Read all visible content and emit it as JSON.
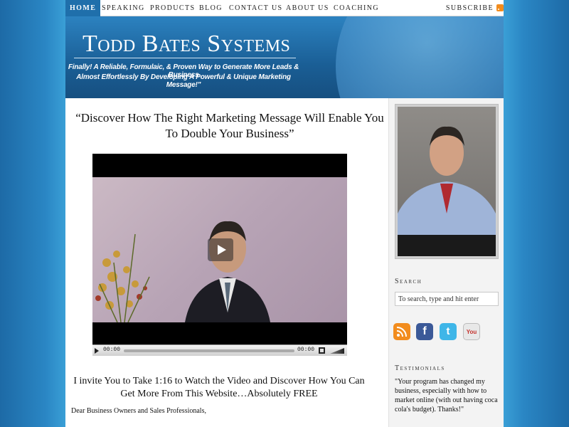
{
  "nav": {
    "items": [
      "HOME",
      "SPEAKING",
      "PRODUCTS",
      "BLOG",
      "CONTACT US",
      "ABOUT US",
      "COACHING"
    ],
    "subscribe": "SUBSCRIBE"
  },
  "header": {
    "title": "Todd Bates Systems",
    "tagline_line1": "Finally! A Reliable, Formulaic, & Proven Way to Generate More Leads & Business",
    "tagline_line2": "Almost Effortlessly By Developing A Powerful & Unique Marketing Message!\""
  },
  "main": {
    "headline": "“Discover How The Right Marketing Message Will Enable You To Double Your Business”",
    "video": {
      "time_current": "00:00",
      "time_total": "00:00"
    },
    "invite": "I invite You to Take 1:16 to Watch the Video and Discover How You Can Get More From This Website…Absolutely FREE",
    "salutation": "Dear Business Owners and Sales Professionals,"
  },
  "sidebar": {
    "search_heading": "Search",
    "search_placeholder": "To search, type and hit enter",
    "social": [
      {
        "icon": "rss-icon",
        "glyph": "",
        "color": "#f28c1d"
      },
      {
        "icon": "facebook-icon",
        "glyph": "f",
        "color": "#3b5998"
      },
      {
        "icon": "twitter-icon",
        "glyph": "t",
        "color": "#3fb6e8"
      },
      {
        "icon": "youtube-icon",
        "glyph": "You",
        "color": "#e8e8e8"
      }
    ],
    "testimonials_heading": "Testimonials",
    "testimonial_text": "\"Your program has changed my business, especially with how to market online (with out having coca cola's budget). Thanks!\""
  },
  "colors": {
    "accent": "#1f6fab",
    "background": "#3a9fd6"
  }
}
